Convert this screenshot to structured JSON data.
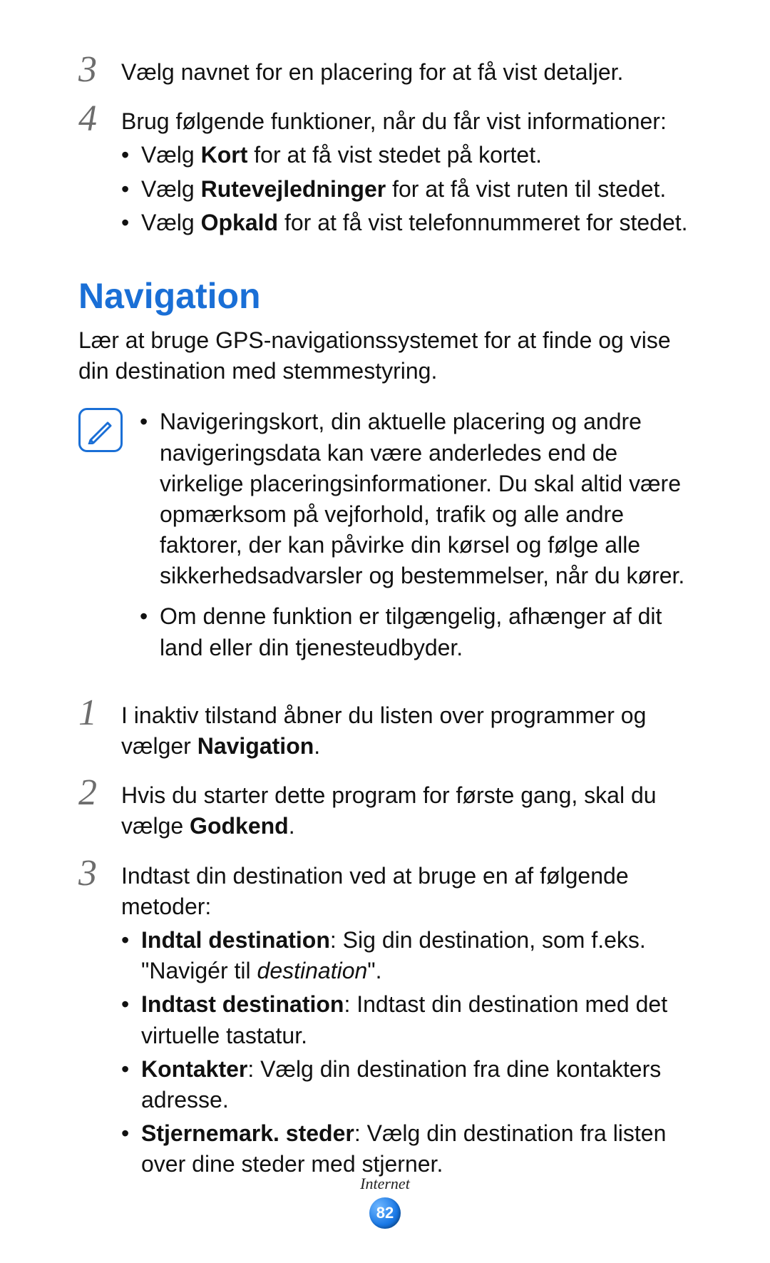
{
  "upperSteps": [
    {
      "num": "3",
      "text": "Vælg navnet for en placering for at få vist detaljer."
    },
    {
      "num": "4",
      "text": "Brug følgende funktioner, når du får vist informationer:",
      "bullets": [
        {
          "pre": "Vælg ",
          "bold": "Kort",
          "post": " for at få vist stedet på kortet."
        },
        {
          "pre": "Vælg ",
          "bold": "Rutevejledninger",
          "post": " for at få vist ruten til stedet."
        },
        {
          "pre": "Vælg ",
          "bold": "Opkald",
          "post": " for at få vist telefonnummeret for stedet."
        }
      ]
    }
  ],
  "section": {
    "heading": "Navigation",
    "lead": "Lær at bruge GPS-navigationssystemet for at finde og vise din destination med stemmestyring.",
    "notes": [
      "Navigeringskort, din aktuelle placering og andre navigeringsdata kan være anderledes end de virkelige placeringsinformationer. Du skal altid være opmærksom på vejforhold, trafik og alle andre faktorer, der kan påvirke din kørsel og følge alle sikkerhedsadvarsler og bestemmelser, når du kører.",
      "Om denne funktion er tilgængelig, afhænger af dit land eller din tjenesteudbyder."
    ],
    "steps": [
      {
        "num": "1",
        "pre": "I inaktiv tilstand åbner du listen over programmer og vælger ",
        "bold": "Navigation",
        "post": "."
      },
      {
        "num": "2",
        "pre": "Hvis du starter dette program for første gang, skal du vælge ",
        "bold": "Godkend",
        "post": "."
      },
      {
        "num": "3",
        "text": "Indtast din destination ved at bruge en af følgende metoder:",
        "bullets": [
          {
            "bold": "Indtal destination",
            "mid": ": Sig din destination, som f.eks. \"Navigér til ",
            "ital": "destination",
            "post": "\"."
          },
          {
            "bold": "Indtast destination",
            "post": ": Indtast din destination med det virtuelle tastatur."
          },
          {
            "bold": "Kontakter",
            "post": ": Vælg din destination fra dine kontakters adresse."
          },
          {
            "bold": "Stjernemark. steder",
            "post": ": Vælg din destination fra listen over dine steder med stjerner."
          }
        ]
      }
    ]
  },
  "footer": {
    "section": "Internet",
    "page": "82"
  }
}
